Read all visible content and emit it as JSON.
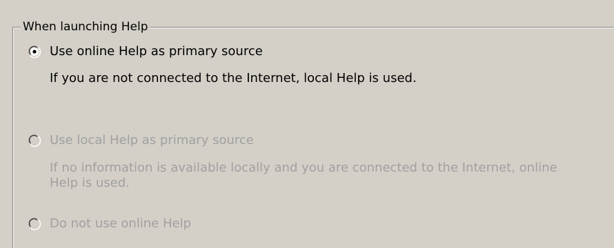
{
  "group": {
    "title": "When launching Help"
  },
  "options": [
    {
      "label": "Use online Help as primary source",
      "description": "If you are not connected to the Internet, local Help is used.",
      "selected": true,
      "enabled": true
    },
    {
      "label": "Use local Help as primary source",
      "description_line1": "If no information is available locally and you are connected to the Internet, online",
      "description_line2": "Help is used.",
      "selected": false,
      "enabled": false
    },
    {
      "label": "Do not use online Help",
      "selected": false,
      "enabled": false
    }
  ],
  "colors": {
    "background": "#d4d0c8",
    "enabled_text": "#000000",
    "disabled_text": "#a0a0a0"
  }
}
